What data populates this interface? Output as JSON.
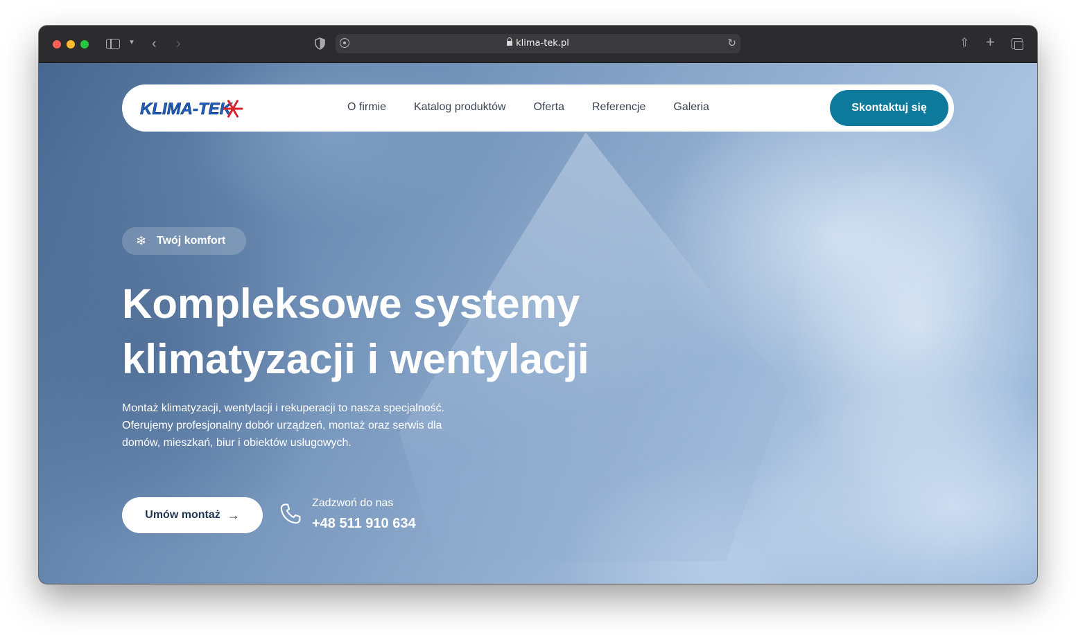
{
  "browser": {
    "url": "klima-tek.pl"
  },
  "site": {
    "logo_text": "KLIMA-TEK",
    "nav": [
      {
        "label": "O firmie"
      },
      {
        "label": "Katalog produktów"
      },
      {
        "label": "Oferta"
      },
      {
        "label": "Referencje"
      },
      {
        "label": "Galeria"
      }
    ],
    "cta_label": "Skontaktuj się"
  },
  "hero": {
    "badge": "Twój komfort",
    "badge_icon": "snowflake-icon",
    "title_line1": "Kompleksowe systemy",
    "title_line2": "klimatyzacji i wentylacji",
    "desc_line1": "Montaż klimatyzacji, wentylacji i rekuperacji to nasza specjalność.",
    "desc_line2": "Oferujemy profesjonalny dobór urządzeń, montaż oraz serwis dla",
    "desc_line3": "domów, mieszkań, biur i obiektów usługowych.",
    "primary_button": "Umów montaż",
    "call_label": "Zadzwoń do nas",
    "phone": "+48 511 910 634"
  },
  "colors": {
    "accent": "#0e7a9c",
    "button_text": "#1f3652",
    "nav_text": "#3b4453"
  }
}
